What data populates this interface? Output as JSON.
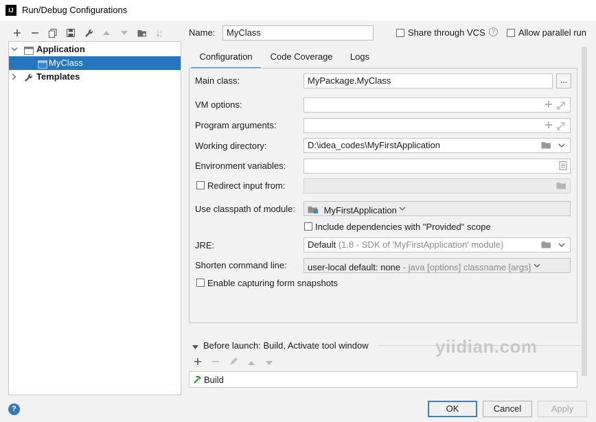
{
  "window": {
    "title": "Run/Debug Configurations",
    "app_icon": "IJ"
  },
  "toolbar": {
    "icons": [
      "plus-icon",
      "minus-icon",
      "copy-icon",
      "save-icon",
      "wrench-icon",
      "arrow-up-icon",
      "arrow-down-icon",
      "folder-add-icon",
      "sort-icon"
    ]
  },
  "tree": {
    "application": "Application",
    "myclass": "MyClass",
    "templates": "Templates"
  },
  "name_row": {
    "name_label": "Name:",
    "name_value": "MyClass",
    "share_label": "Share through VCS",
    "parallel_label": "Allow parallel run"
  },
  "tabs": [
    "Configuration",
    "Code Coverage",
    "Logs"
  ],
  "form": {
    "main_class_label": "Main class:",
    "main_class_value": "MyPackage.MyClass",
    "browse_label": "...",
    "vm_label": "VM options:",
    "program_args_label": "Program arguments:",
    "working_dir_label": "Working directory:",
    "working_dir_value": "D:\\idea_codes\\MyFirstApplication",
    "env_label": "Environment variables:",
    "redirect_label": "Redirect input from:",
    "classpath_label": "Use classpath of module:",
    "classpath_value": "MyFirstApplication",
    "include_deps_label": "Include dependencies with \"Provided\" scope",
    "jre_label": "JRE:",
    "jre_value": "Default",
    "jre_hint": "(1.8 - SDK of 'MyFirstApplication' module)",
    "shorten_label": "Shorten command line:",
    "shorten_value": "user-local default: none",
    "shorten_hint": "- java [options] classname [args]",
    "snapshots_label": "Enable capturing form snapshots"
  },
  "before_launch": {
    "title": "Before launch: Build, Activate tool window",
    "item": "Build"
  },
  "buttons": {
    "ok": "OK",
    "cancel": "Cancel",
    "apply": "Apply",
    "help": "?"
  },
  "watermark": "yiidian.com",
  "colors": {
    "accent": "#2675bf",
    "tab_underline": "#4083c9"
  }
}
